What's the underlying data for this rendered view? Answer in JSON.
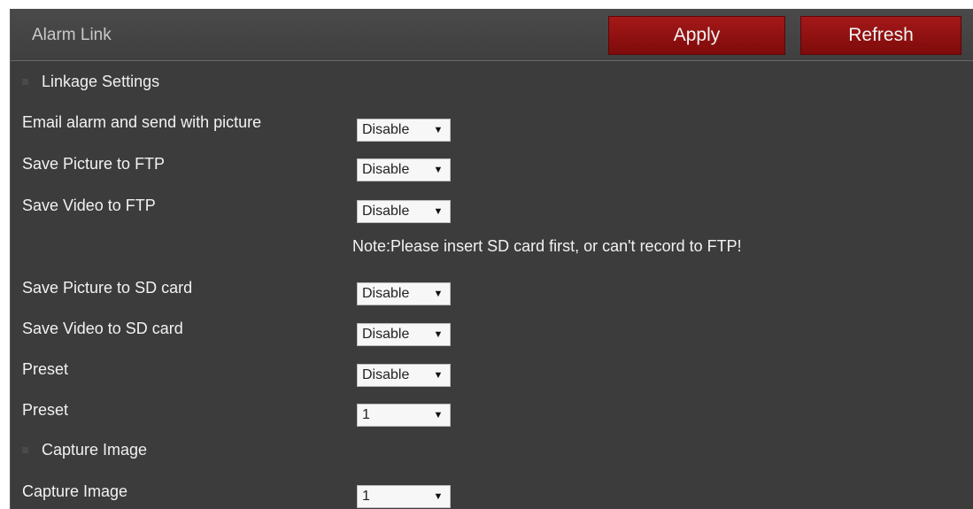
{
  "header": {
    "title": "Alarm Link",
    "apply_label": "Apply",
    "refresh_label": "Refresh"
  },
  "sections": {
    "linkage": "Linkage Settings",
    "capture": "Capture Image"
  },
  "rows": {
    "email": {
      "label": "Email alarm and send with picture",
      "value": "Disable"
    },
    "pic_ftp": {
      "label": "Save Picture to FTP",
      "value": "Disable"
    },
    "video_ftp": {
      "label": "Save Video to FTP",
      "value": "Disable"
    },
    "pic_sd": {
      "label": "Save Picture to SD card",
      "value": "Disable"
    },
    "video_sd": {
      "label": "Save Video to SD card",
      "value": "Disable"
    },
    "preset_enable": {
      "label": "Preset",
      "value": "Disable"
    },
    "preset_num": {
      "label": "Preset",
      "value": "1"
    },
    "capture": {
      "label": "Capture Image",
      "value": "1"
    }
  },
  "note": "Note:Please insert SD card first, or can't record to FTP!",
  "colors": {
    "panel_bg": "#3c3c3c",
    "button": "#961313"
  }
}
